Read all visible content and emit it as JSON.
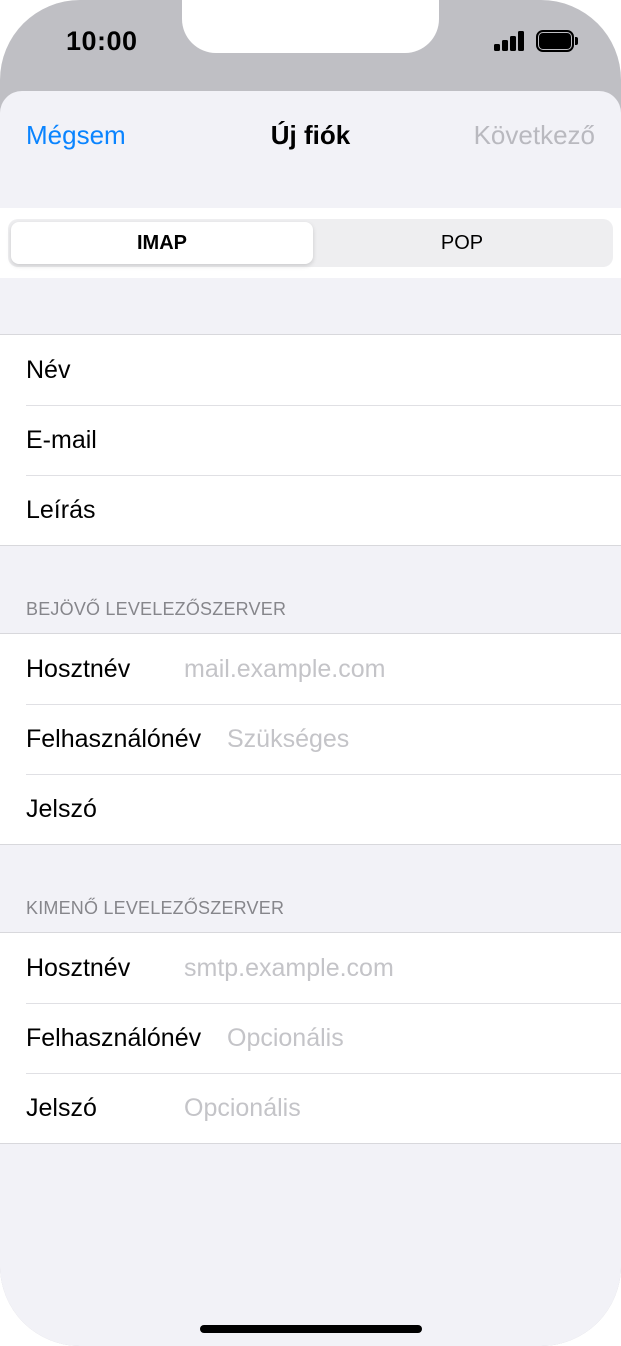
{
  "status": {
    "time": "10:00"
  },
  "nav": {
    "cancel": "Mégsem",
    "title": "Új fiók",
    "next": "Következő"
  },
  "segments": {
    "imap": "IMAP",
    "pop": "POP",
    "selected": "IMAP"
  },
  "account": {
    "name_label": "Név",
    "email_label": "E-mail",
    "description_label": "Leírás"
  },
  "incoming": {
    "header": "BEJÖVŐ LEVELEZŐSZERVER",
    "host_label": "Hosztnév",
    "host_placeholder": "mail.example.com",
    "user_label": "Felhasználónév",
    "user_placeholder": "Szükséges",
    "password_label": "Jelszó"
  },
  "outgoing": {
    "header": "KIMENŐ LEVELEZŐSZERVER",
    "host_label": "Hosztnév",
    "host_placeholder": "smtp.example.com",
    "user_label": "Felhasználónév",
    "user_placeholder": "Opcionális",
    "password_label": "Jelszó",
    "password_placeholder": "Opcionális"
  },
  "colors": {
    "accent": "#0a84ff",
    "disabled": "#b9b9bf",
    "placeholder": "#c4c4c8",
    "background": "#f2f2f7"
  },
  "icons": [
    "cellular-signal-icon",
    "battery-icon"
  ]
}
